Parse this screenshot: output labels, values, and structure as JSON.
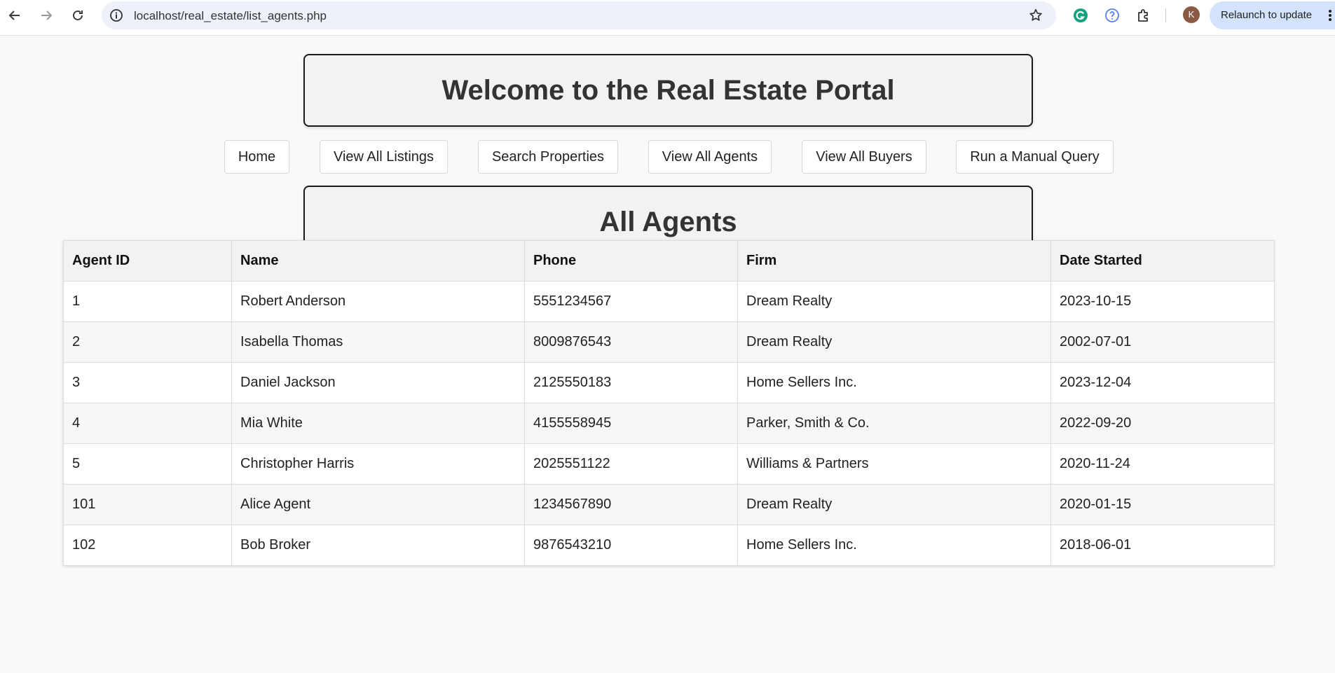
{
  "browser": {
    "url": "localhost/real_estate/list_agents.php",
    "relaunch_label": "Relaunch to update",
    "avatar_letter": "K"
  },
  "header": {
    "title": "Welcome to the Real Estate Portal"
  },
  "nav": {
    "items": [
      {
        "label": "Home"
      },
      {
        "label": "View All Listings"
      },
      {
        "label": "Search Properties"
      },
      {
        "label": "View All Agents"
      },
      {
        "label": "View All Buyers"
      },
      {
        "label": "Run a Manual Query"
      }
    ]
  },
  "section": {
    "title": "All Agents"
  },
  "table": {
    "columns": [
      "Agent ID",
      "Name",
      "Phone",
      "Firm",
      "Date Started"
    ],
    "rows": [
      [
        "1",
        "Robert Anderson",
        "5551234567",
        "Dream Realty",
        "2023-10-15"
      ],
      [
        "2",
        "Isabella Thomas",
        "8009876543",
        "Dream Realty",
        "2002-07-01"
      ],
      [
        "3",
        "Daniel Jackson",
        "2125550183",
        "Home Sellers Inc.",
        "2023-12-04"
      ],
      [
        "4",
        "Mia White",
        "4155558945",
        "Parker, Smith & Co.",
        "2022-09-20"
      ],
      [
        "5",
        "Christopher Harris",
        "2025551122",
        "Williams & Partners",
        "2020-11-24"
      ],
      [
        "101",
        "Alice Agent",
        "1234567890",
        "Dream Realty",
        "2020-01-15"
      ],
      [
        "102",
        "Bob Broker",
        "9876543210",
        "Home Sellers Inc.",
        "2018-06-01"
      ]
    ]
  }
}
